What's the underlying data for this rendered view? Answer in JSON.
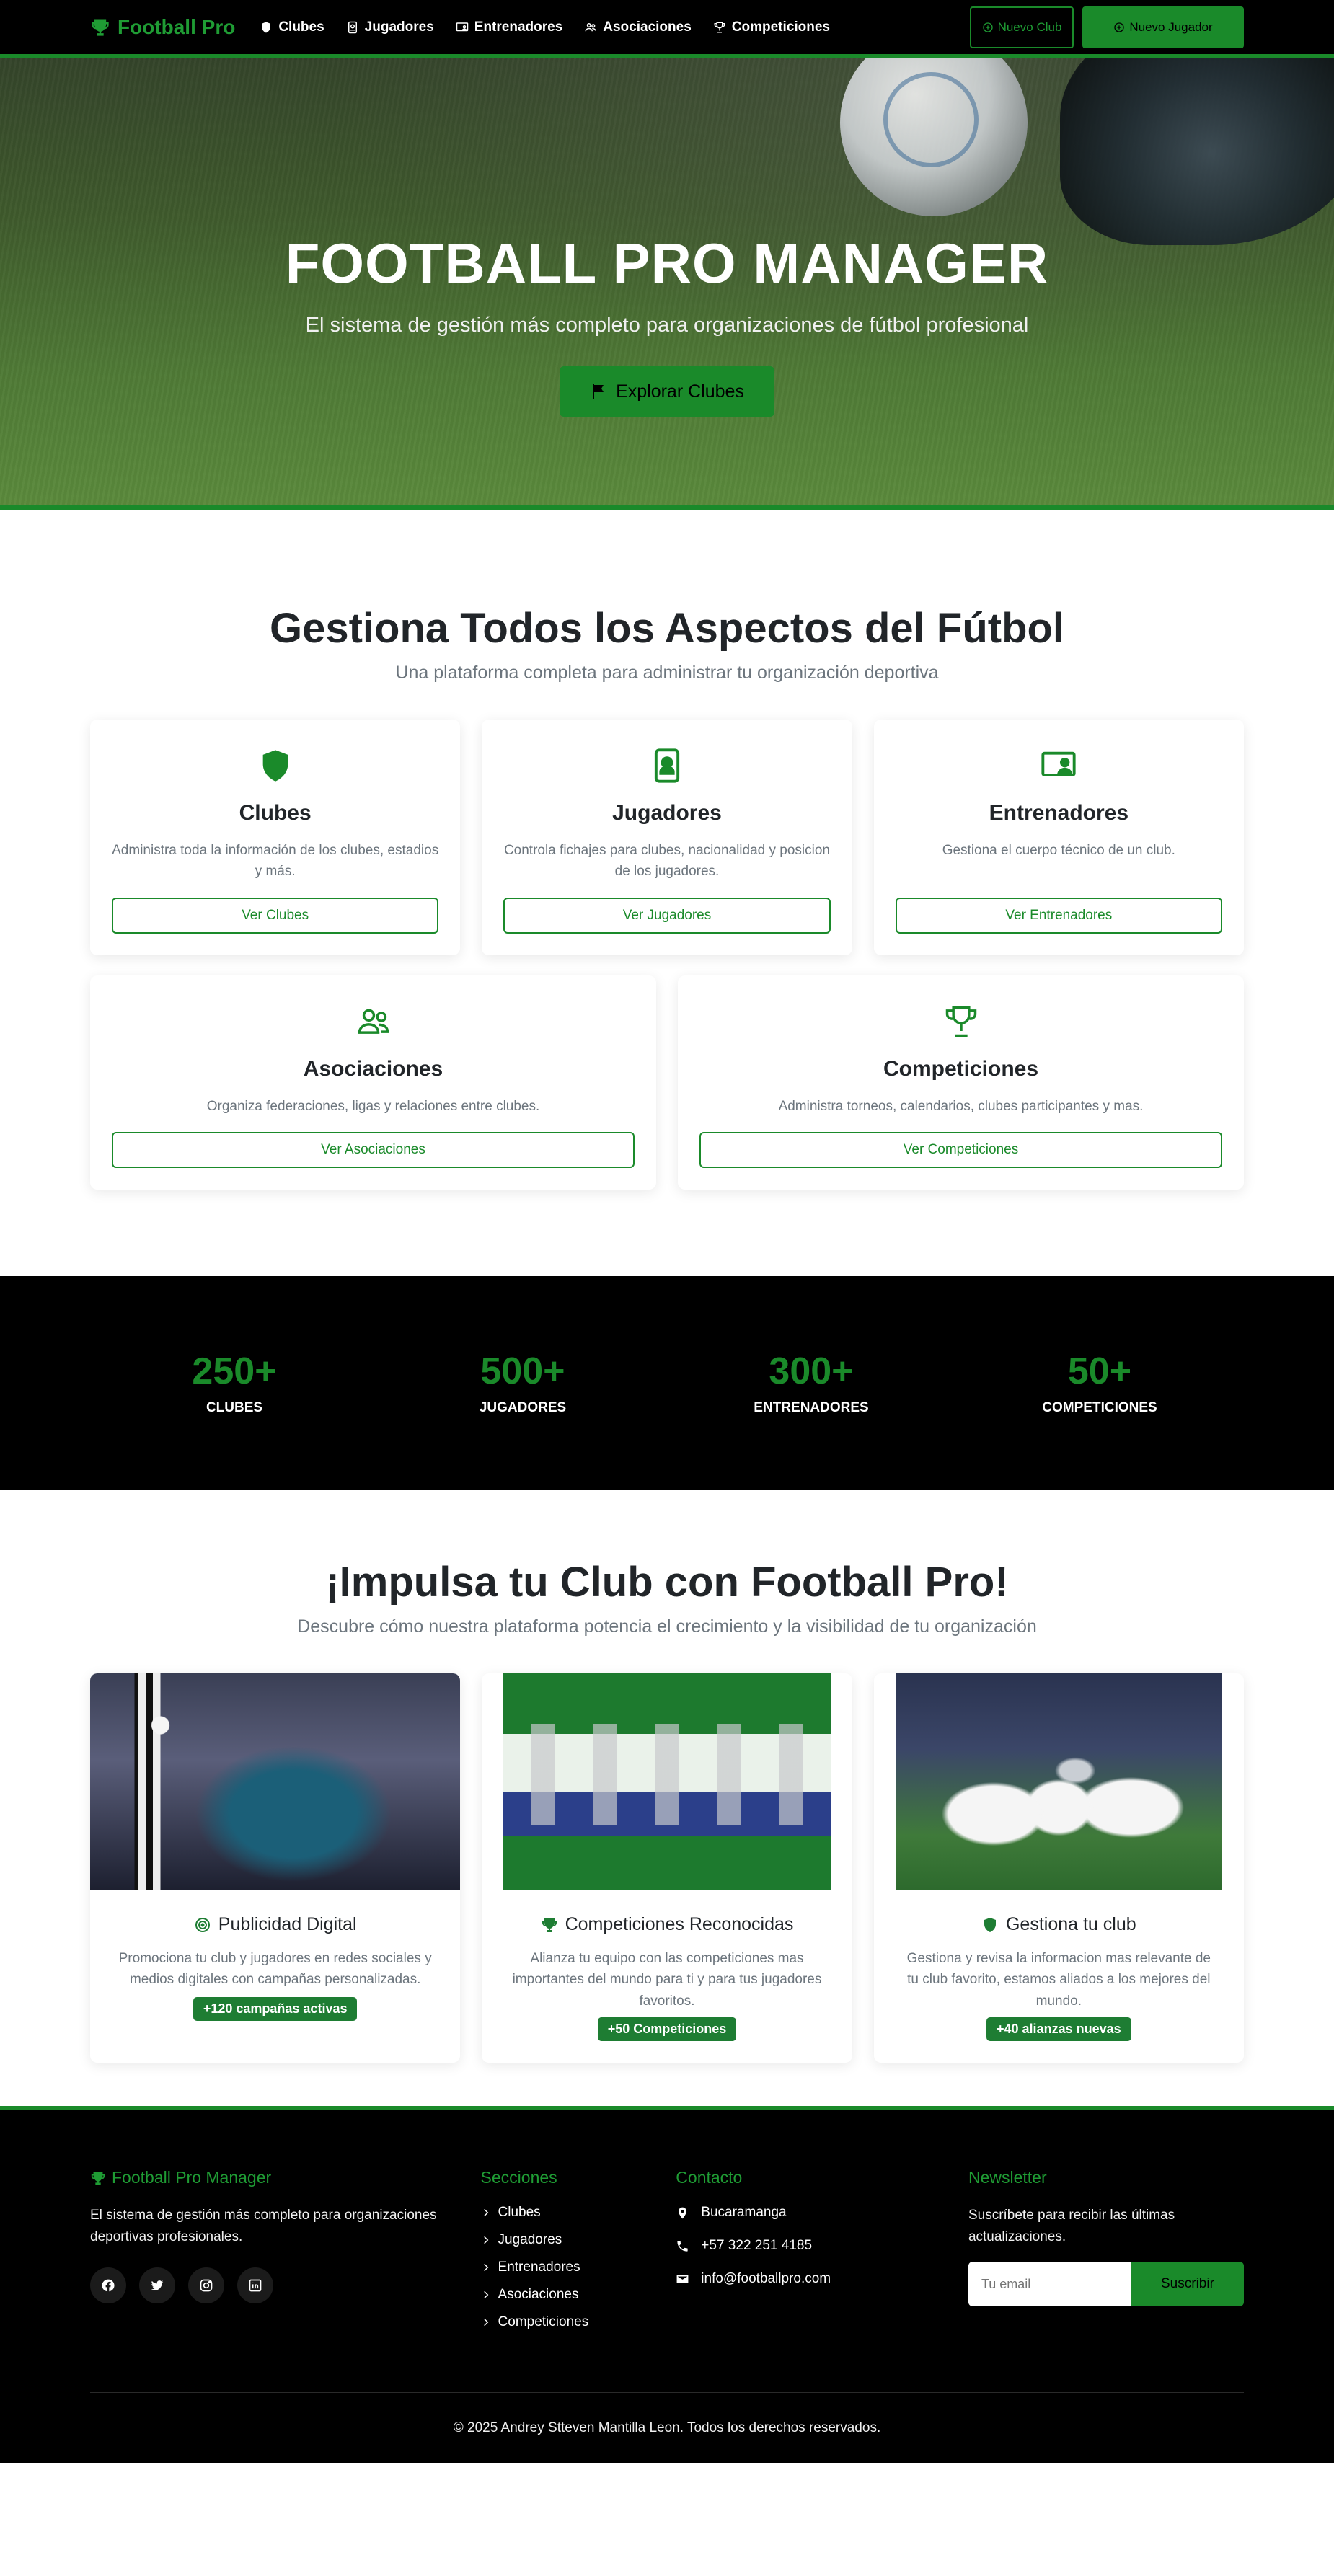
{
  "nav": {
    "brand": "Football Pro",
    "links": [
      {
        "label": "Clubes",
        "icon": "shield-icon"
      },
      {
        "label": "Jugadores",
        "icon": "id-badge-icon"
      },
      {
        "label": "Entrenadores",
        "icon": "coach-icon"
      },
      {
        "label": "Asociaciones",
        "icon": "people-icon"
      },
      {
        "label": "Competiciones",
        "icon": "trophy-icon"
      }
    ],
    "new_club": "Nuevo Club",
    "new_player": "Nuevo Jugador"
  },
  "hero": {
    "title": "FOOTBALL PRO MANAGER",
    "subtitle": "El sistema de gestión más completo para organizaciones de fútbol profesional",
    "cta": "Explorar Clubes"
  },
  "features": {
    "title": "Gestiona Todos los Aspectos del Fútbol",
    "subtitle": "Una plataforma completa para administrar tu organización deportiva",
    "cards": [
      {
        "title": "Clubes",
        "desc": "Administra toda la información de los clubes, estadios y más.",
        "button": "Ver Clubes",
        "icon": "shield-icon"
      },
      {
        "title": "Jugadores",
        "desc": "Controla fichajes para clubes, nacionalidad y posicion de los jugadores.",
        "button": "Ver Jugadores",
        "icon": "id-badge-icon"
      },
      {
        "title": "Entrenadores",
        "desc": "Gestiona el cuerpo técnico de un club.",
        "button": "Ver Entrenadores",
        "icon": "coach-icon"
      },
      {
        "title": "Asociaciones",
        "desc": "Organiza federaciones, ligas y relaciones entre clubes.",
        "button": "Ver Asociaciones",
        "icon": "people-icon"
      },
      {
        "title": "Competiciones",
        "desc": "Administra torneos, calendarios, clubes participantes y mas.",
        "button": "Ver Competiciones",
        "icon": "trophy-icon"
      }
    ]
  },
  "stats": [
    {
      "value": "250+",
      "label": "CLUBES"
    },
    {
      "value": "500+",
      "label": "JUGADORES"
    },
    {
      "value": "300+",
      "label": "ENTRENADORES"
    },
    {
      "value": "50+",
      "label": "COMPETICIONES"
    }
  ],
  "promo": {
    "title": "¡Impulsa tu Club con Football Pro!",
    "subtitle": "Descubre cómo nuestra plataforma potencia el crecimiento y la visibilidad de tu organización",
    "cards": [
      {
        "title": "Publicidad Digital",
        "desc": "Promociona tu club y jugadores en redes sociales y medios digitales con campañas personalizadas.",
        "badge": "+120 campañas activas",
        "icon": "bullseye-icon"
      },
      {
        "title": "Competiciones Reconocidas",
        "desc": "Alianza tu equipo con las competiciones mas importantes del mundo para ti y para tus jugadores favoritos.",
        "badge": "+50 Competiciones",
        "icon": "trophy-icon"
      },
      {
        "title": "Gestiona tu club",
        "desc": "Gestiona y revisa la informacion mas relevante de tu club favorito, estamos aliados a los mejores del mundo.",
        "badge": "+40 alianzas nuevas",
        "icon": "shield-icon"
      }
    ]
  },
  "footer": {
    "brand": "Football Pro Manager",
    "about": "El sistema de gestión más completo para organizaciones deportivas profesionales.",
    "socials": [
      "facebook-icon",
      "twitter-icon",
      "instagram-icon",
      "linkedin-icon"
    ],
    "sections_title": "Secciones",
    "sections": [
      "Clubes",
      "Jugadores",
      "Entrenadores",
      "Asociaciones",
      "Competiciones"
    ],
    "contact_title": "Contacto",
    "contact": {
      "city": "Bucaramanga",
      "phone": "+57 322 251 4185",
      "email": "info@footballpro.com"
    },
    "newsletter_title": "Newsletter",
    "newsletter_text": "Suscríbete para recibir las últimas actualizaciones.",
    "email_placeholder": "Tu email",
    "subscribe": "Suscribir",
    "copyright": "© 2025 Andrey Stteven Mantilla Leon. Todos los derechos reservados."
  },
  "colors": {
    "accent": "#1a8a2a",
    "dark": "#000000",
    "badge": "#1e7d33"
  }
}
